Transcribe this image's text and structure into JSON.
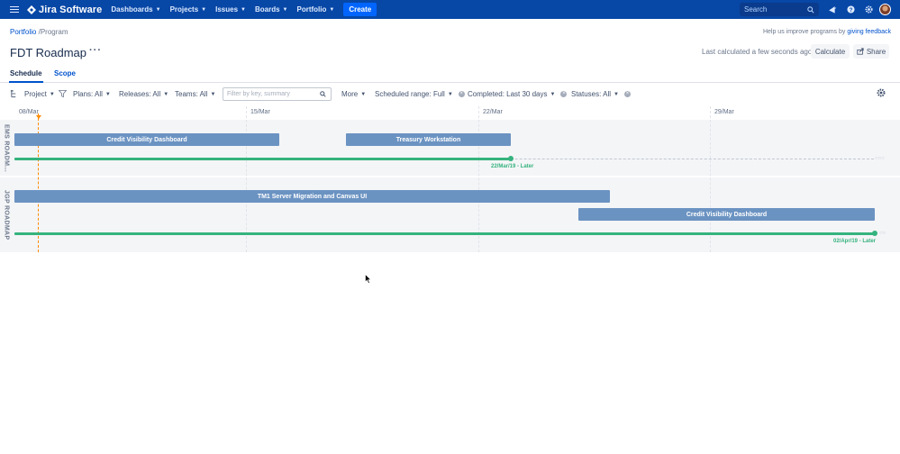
{
  "nav": {
    "app_name": "Jira Software",
    "items": [
      {
        "label": "Dashboards"
      },
      {
        "label": "Projects"
      },
      {
        "label": "Issues"
      },
      {
        "label": "Boards"
      },
      {
        "label": "Portfolio"
      }
    ],
    "create_label": "Create",
    "search_placeholder": "Search",
    "brand_color": "#0747a6"
  },
  "header": {
    "breadcrumb_root": "Portfolio",
    "breadcrumb_current": "/Program",
    "title": "FDT Roadmap",
    "help_text": "Help us improve programs by",
    "help_link": "giving feedback",
    "calc_status": "Last calculated a few seconds ago",
    "calculate_label": "Calculate",
    "share_label": "Share"
  },
  "tabs": [
    {
      "label": "Schedule",
      "active": true
    },
    {
      "label": "Scope",
      "active": false
    }
  ],
  "filters": {
    "project": "Project",
    "plans": "Plans: All",
    "releases": "Releases: All",
    "teams": "Teams: All",
    "filter_placeholder": "Filter by key, summary",
    "more": "More",
    "scheduled_range": "Scheduled range: Full",
    "completed": "Completed: Last 30 days",
    "statuses": "Statuses: All"
  },
  "timeline": {
    "dates": [
      "08/Mar",
      "15/Mar",
      "22/Mar",
      "29/Mar"
    ],
    "lanes": [
      {
        "name": "EMS ROADM...",
        "bars": [
          {
            "label": "Credit Visibility Dashboard"
          },
          {
            "label": "Treasury Workstation"
          }
        ],
        "progress_date": "22/Mar/19 - Later"
      },
      {
        "name": "JGP ROADMAP",
        "bars": [
          {
            "label": "TM1 Server Migration and Canvas UI"
          },
          {
            "label": "Credit Visibility Dashboard"
          }
        ],
        "progress_date": "02/Apr/19 - Later"
      }
    ],
    "bar_color": "#6b93c2",
    "progress_color": "#36b37e",
    "today_color": "#ff8b00"
  }
}
